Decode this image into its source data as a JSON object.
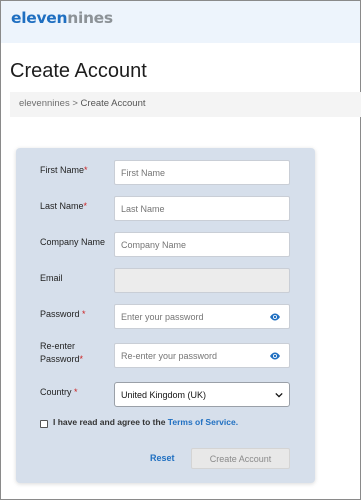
{
  "brand": {
    "logo_part1": "eleven",
    "logo_part2": "nines"
  },
  "page": {
    "title": "Create Account"
  },
  "breadcrumb": {
    "home": "elevennines",
    "separator": " > ",
    "current": "Create Account"
  },
  "form": {
    "first_name": {
      "label": "First Name",
      "required_mark": "*",
      "placeholder": "First Name",
      "value": ""
    },
    "last_name": {
      "label": "Last Name",
      "required_mark": "*",
      "placeholder": "Last Name",
      "value": ""
    },
    "company_name": {
      "label": "Company Name",
      "placeholder": "Company Name",
      "value": ""
    },
    "email": {
      "label": "Email",
      "value": ""
    },
    "password": {
      "label": "Password ",
      "required_mark": "*",
      "placeholder": "Enter your password"
    },
    "reenter_password": {
      "label_line1": "Re-enter",
      "label_line2": "Password",
      "required_mark": "*",
      "placeholder": "Re-enter your password"
    },
    "country": {
      "label": "Country ",
      "required_mark": "*",
      "selected": "United Kingdom (UK)"
    },
    "terms": {
      "text": "I have read and agree to the ",
      "link": "Terms of Service",
      "suffix": ".",
      "checked": false
    },
    "reset_label": "Reset",
    "create_label": "Create Account"
  },
  "colors": {
    "accent": "#1f6fc1",
    "card_bg": "#d6dfeb",
    "topbar_bg": "#edf4fc",
    "required": "#cc2222"
  },
  "icons": {
    "password_toggle": "eye-icon",
    "select_arrow": "chevron-down-icon"
  }
}
